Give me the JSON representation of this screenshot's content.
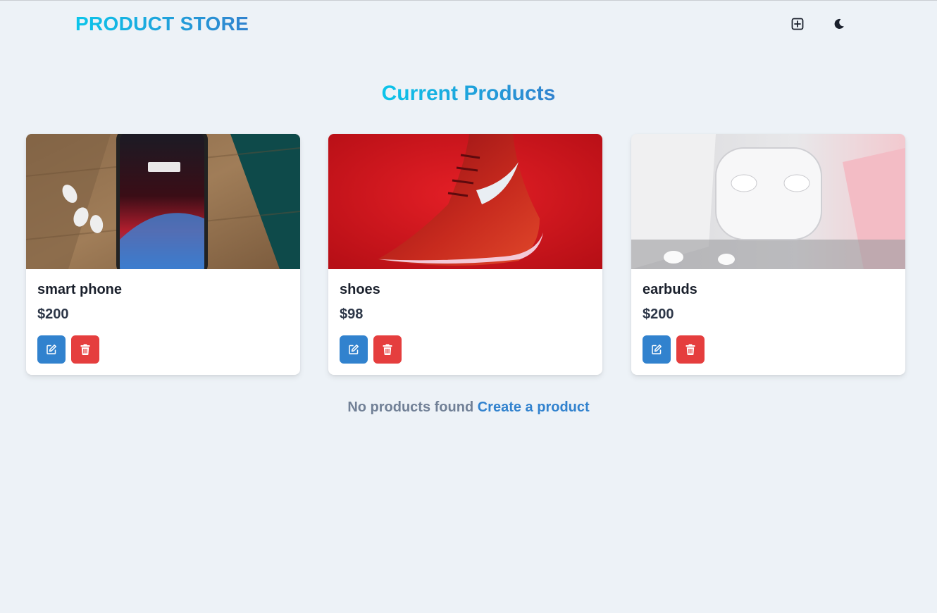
{
  "navbar": {
    "brand": "PRODUCT STORE",
    "add_icon": "plus-square-icon",
    "theme_icon": "moon-icon"
  },
  "main": {
    "heading": "Current Products",
    "products": [
      {
        "name": "smart phone",
        "price": "$200",
        "image": "smartphone-photo"
      },
      {
        "name": "shoes",
        "price": "$98",
        "image": "red-sneaker-photo"
      },
      {
        "name": "earbuds",
        "price": "$200",
        "image": "earbuds-photo"
      }
    ],
    "empty_text": "No products found",
    "create_link": "Create a product"
  },
  "colors": {
    "background": "#edf2f7",
    "accent_start": "#0bc5ea",
    "accent_end": "#3182ce",
    "edit_button": "#3182ce",
    "delete_button": "#e53e3e"
  }
}
